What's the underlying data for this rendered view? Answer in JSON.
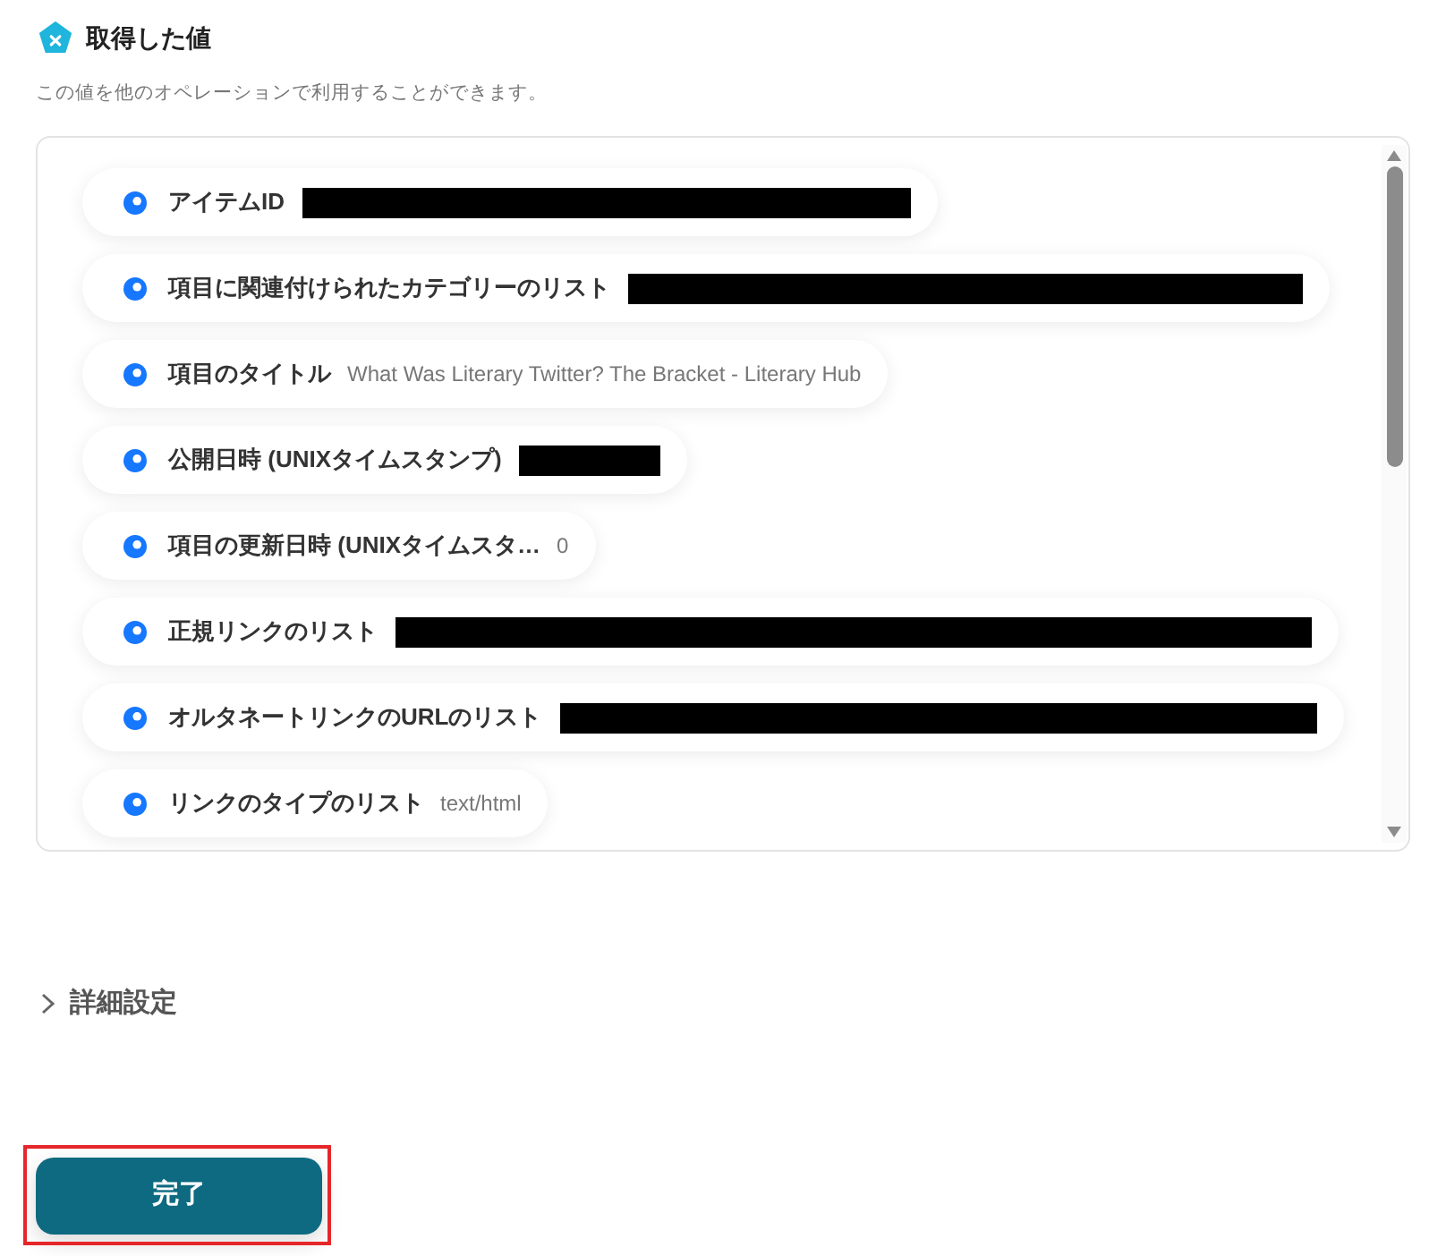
{
  "section": {
    "title": "取得した値",
    "description": "この値を他のオペレーションで利用することができます。"
  },
  "outputs": [
    {
      "label": "アイテムID",
      "kind": "redacted"
    },
    {
      "label": "項目に関連付けられたカテゴリーのリスト",
      "kind": "redacted"
    },
    {
      "label": "項目のタイトル",
      "kind": "text",
      "value": "What Was Literary Twitter? The Bracket - Literary Hub"
    },
    {
      "label": "公開日時 (UNIXタイムスタンプ)",
      "kind": "redacted"
    },
    {
      "label": "項目の更新日時 (UNIXタイムスタ…",
      "kind": "text",
      "value": "0"
    },
    {
      "label": "正規リンクのリスト",
      "kind": "redacted"
    },
    {
      "label": "オルタネートリンクのURLのリスト",
      "kind": "redacted"
    },
    {
      "label": "リンクのタイプのリスト",
      "kind": "text",
      "value": "text/html"
    }
  ],
  "advanced_settings": {
    "label": "詳細設定",
    "expanded": false
  },
  "submit_button": {
    "label": "完了",
    "highlighted": true
  }
}
